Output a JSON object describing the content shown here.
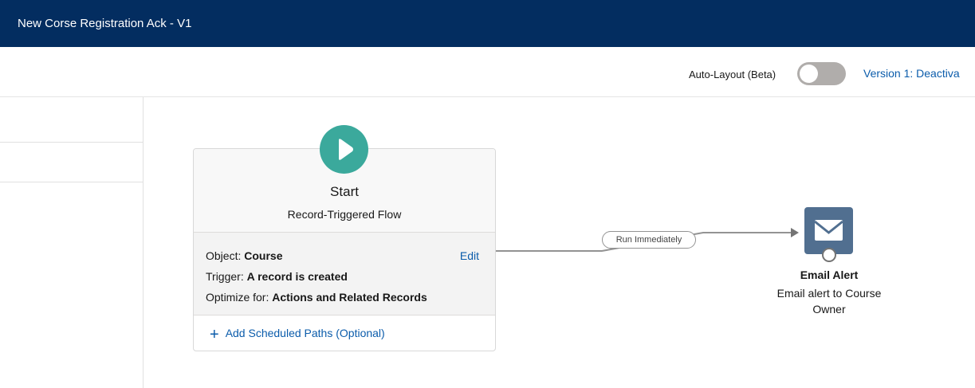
{
  "header": {
    "title": "New Corse Registration Ack - V1"
  },
  "toolbar": {
    "auto_layout_label": "Auto-Layout (Beta)",
    "auto_layout_on": false,
    "version_label": "Version 1: Deactiva"
  },
  "start_node": {
    "icon": "play-icon",
    "title": "Start",
    "subtitle": "Record-Triggered Flow",
    "object_label": "Object:",
    "object_value": "Course",
    "edit_label": "Edit",
    "trigger_label": "Trigger:",
    "trigger_value": "A record is created",
    "optimize_label": "Optimize for:",
    "optimize_value": "Actions and Related Records",
    "add_paths_label": "Add Scheduled Paths (Optional)"
  },
  "connector": {
    "label": "Run Immediately"
  },
  "email_node": {
    "icon": "envelope-icon",
    "title": "Email Alert",
    "description": "Email alert to Course Owner"
  },
  "colors": {
    "header_bg": "#032d60",
    "start_icon": "#3ba99c",
    "email_icon": "#516f90",
    "link": "#0b5cab"
  }
}
